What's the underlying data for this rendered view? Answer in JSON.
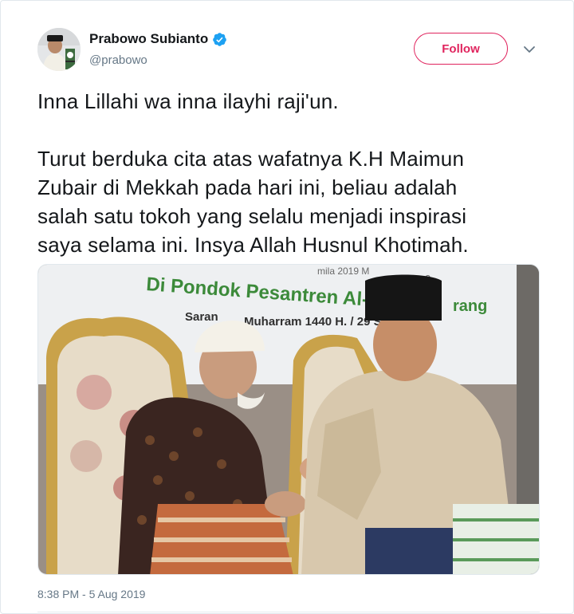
{
  "user": {
    "display_name": "Prabowo Subianto",
    "handle": "@prabowo",
    "verified": true,
    "verified_color": "#1da1f2"
  },
  "actions": {
    "follow_label": "Follow",
    "follow_color": "#e0245e",
    "caret_icon": "chevron-down-icon"
  },
  "tweet": {
    "line1": "Inna Lillahi wa inna ilayhi raji'un.",
    "paragraph2_lines": [
      "Turut berduka cita atas wafatnya K.H Maimun",
      "Zubair di Mekkah pada hari ini, beliau adalah",
      "salah satu tokoh yang selalu menjadi inspirasi",
      "saya selama ini. Insya Allah Husnul Khotimah."
    ]
  },
  "photo": {
    "banner_line1": "Di Pondok Pesantren Al-",
    "banner_line1_end": "rang",
    "banner_line2": "Saran",
    "banner_line2b": "Muharram 1440 H. / 29 S",
    "banner_top": "mila 2019 M",
    "banner_top_end": "2",
    "banner_text_color": "#3c8a3a"
  },
  "timestamp": "8:38 PM - 5 Aug 2019"
}
